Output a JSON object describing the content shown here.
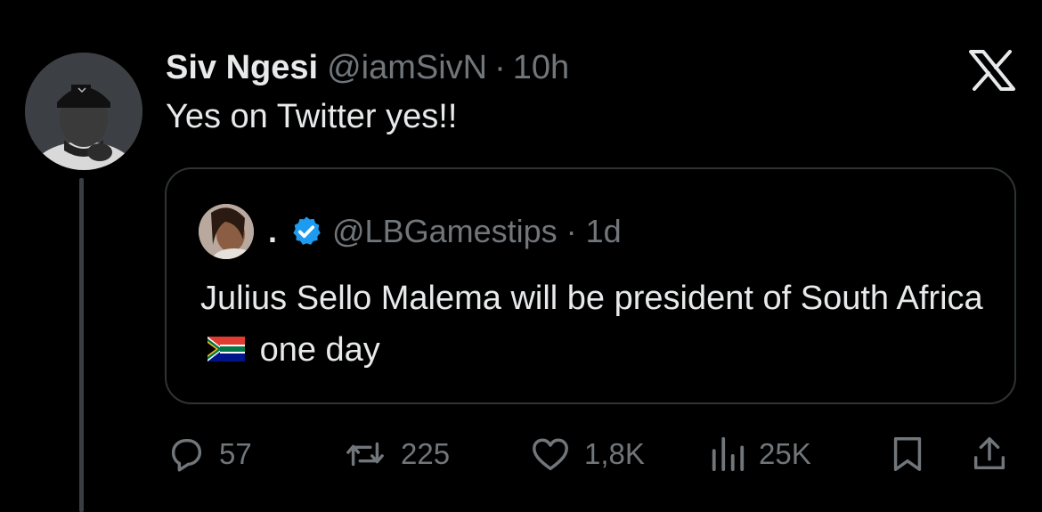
{
  "tweet": {
    "display_name": "Siv Ngesi",
    "handle": "@iamSivN",
    "separator": "·",
    "time": "10h",
    "text": "Yes on Twitter yes!!"
  },
  "quoted_tweet": {
    "display_name": ".",
    "handle": "@LBGamestips",
    "separator": "·",
    "time": "1d",
    "text_before_flag": "Julius Sello Malema will be president of South Africa",
    "text_after_flag": "one day",
    "flag_icon": "south-africa-flag-icon",
    "verified_color": "#1d9bf0"
  },
  "actions": {
    "replies": "57",
    "reposts": "225",
    "likes": "1,8K",
    "views": "25K"
  },
  "icons": {
    "logo": "x-logo-icon",
    "reply": "reply-icon",
    "repost": "repost-icon",
    "like": "heart-icon",
    "views": "views-icon",
    "bookmark": "bookmark-icon",
    "share": "share-icon"
  },
  "colors": {
    "background": "#000000",
    "text": "#e7e9ea",
    "muted": "#71767b",
    "border": "#2f3336"
  }
}
